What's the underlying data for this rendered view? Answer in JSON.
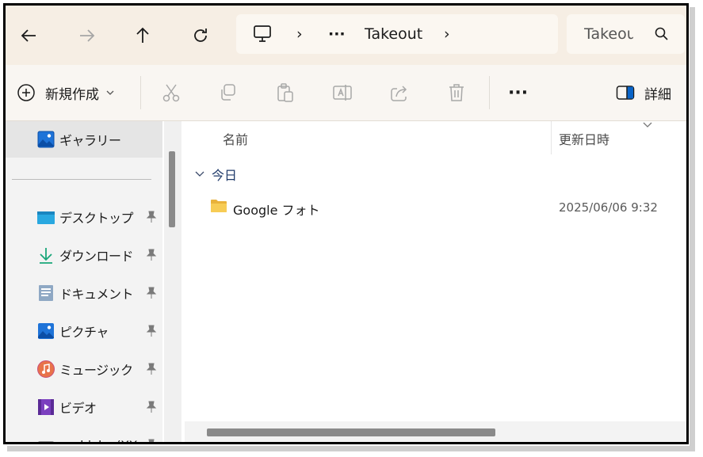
{
  "navigation": {
    "back_icon": "arrow-left-icon",
    "forward_icon": "arrow-right-icon",
    "up_icon": "arrow-up-icon",
    "refresh_icon": "refresh-icon"
  },
  "address_bar": {
    "root_icon": "computer-icon",
    "overflow": "···",
    "current_folder": "Takeout",
    "separator": "›"
  },
  "search": {
    "placeholder": "Takeout",
    "icon": "search-icon"
  },
  "toolbar": {
    "new_label": "新規作成",
    "details_label": "詳細",
    "more": "···"
  },
  "sidebar": {
    "gallery": "ギャラリー",
    "items": [
      {
        "label": "デスクトップ",
        "icon": "desktop-icon",
        "pinned": true
      },
      {
        "label": "ダウンロード",
        "icon": "download-icon",
        "pinned": true
      },
      {
        "label": "ドキュメント",
        "icon": "document-icon",
        "pinned": true
      },
      {
        "label": "ピクチャ",
        "icon": "pictures-icon",
        "pinned": true
      },
      {
        "label": "ミュージック",
        "icon": "music-icon",
        "pinned": true
      },
      {
        "label": "ビデオ",
        "icon": "video-icon",
        "pinned": true
      },
      {
        "label": "yoshioka (XX:",
        "icon": "drive-icon",
        "pinned": true
      }
    ]
  },
  "file_list": {
    "columns": [
      "名前",
      "更新日時"
    ],
    "group_label": "今日",
    "rows": [
      {
        "name": "Google フォト",
        "modified": "2025/06/06 9:32",
        "icon": "folder-icon"
      }
    ]
  },
  "colors": {
    "nav_bg": "#f6eee4",
    "address_bg": "#fbf7f1",
    "selected_bg": "#e5e5e5",
    "accent": "#0a64c8"
  }
}
